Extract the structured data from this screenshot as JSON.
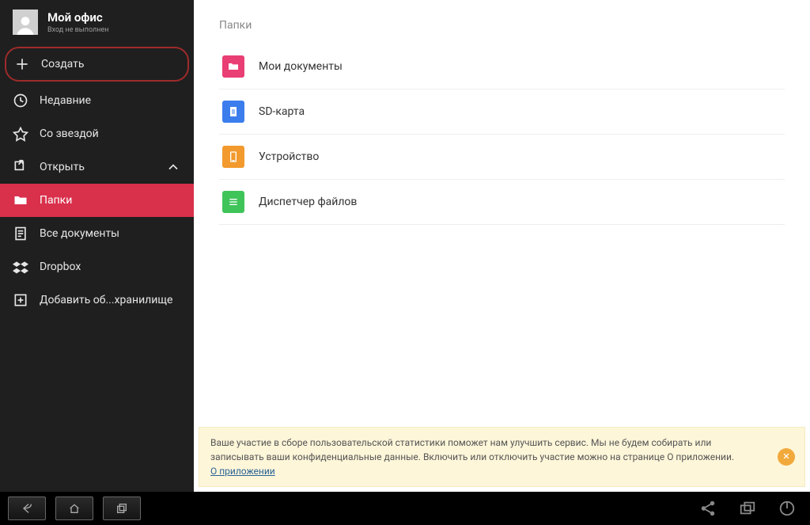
{
  "sidebar": {
    "profile": {
      "title": "Мой офис",
      "subtitle": "Вход не выполнен"
    },
    "create_label": "Создать",
    "recent_label": "Недавние",
    "starred_label": "Со звездой",
    "open_label": "Открыть",
    "sub": {
      "folders_label": "Папки",
      "alldocs_label": "Все документы",
      "dropbox_label": "Dropbox",
      "addstorage_label": "Добавить об...хранилище"
    }
  },
  "main": {
    "section_title": "Папки",
    "folders": [
      {
        "label": "Мои документы",
        "color": "#e93f74",
        "icon": "folder"
      },
      {
        "label": "SD-карта",
        "color": "#3b7ded",
        "icon": "document"
      },
      {
        "label": "Устройство",
        "color": "#f29a2e",
        "icon": "phone"
      },
      {
        "label": "Диспетчер файлов",
        "color": "#3fc45a",
        "icon": "list"
      }
    ]
  },
  "banner": {
    "text": "Ваше участие в сборе пользовательской статистики поможет нам улучшить сервис. Мы не будем собирать или записывать ваши конфиденциальные данные. Включить или отключить участие можно на странице О приложении.",
    "link": "О приложении"
  }
}
